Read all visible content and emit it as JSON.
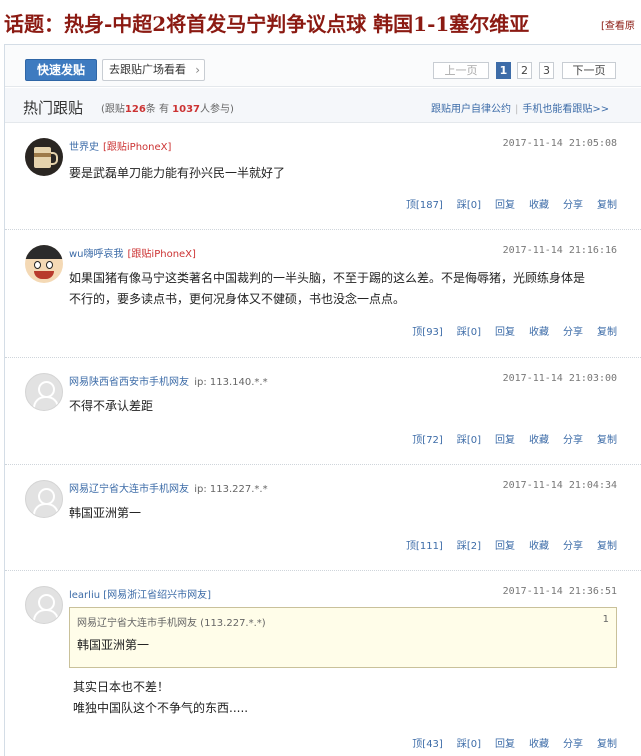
{
  "page": {
    "title": "话题：热身-中超2将首发马宁判争议点球 韩国1-1塞尔维亚",
    "view_link": "[查看原"
  },
  "toolbar": {
    "post_label": "快速发贴",
    "square_label": "去跟贴广场看看",
    "square_icon": "chevron-right-icon",
    "prev_label": "上一页",
    "pages": [
      "1",
      "2",
      "3"
    ],
    "current_page": "1",
    "next_label": "下一页"
  },
  "hot": {
    "title": "热门跟贴",
    "stats_prefix": "(跟贴",
    "reply_count": "126",
    "stats_mid": "条 有",
    "participant_count": "1037",
    "stats_suffix": "人参与)",
    "link_convention": "跟贴用户自律公约",
    "link_mobile": "手机也能看跟贴>>"
  },
  "comments": [
    {
      "avatar_icon": "teacup-avatar",
      "user": "世界史",
      "device": "[跟贴iPhoneX]",
      "time": "2017-11-14 21:05:08",
      "text": "要是武磊单刀能力能有孙兴民一半就好了",
      "actions": [
        "顶[187]",
        "踩[0]",
        "回复",
        "收藏",
        "分享",
        "复制"
      ]
    },
    {
      "avatar_icon": "cartoon-avatar",
      "user": "wu嗨呼哀我",
      "device": "[跟贴iPhoneX]",
      "time": "2017-11-14 21:16:16",
      "text_line1": "如果国猪有像马宁这类著名中国裁判的一半头脑，不至于踢的这么差。不是侮辱猪，光顾练身体是",
      "text_line2": "不行的，要多读点书，更何况身体又不健硕，书也没念一点点。",
      "actions": [
        "顶[93]",
        "踩[0]",
        "回复",
        "收藏",
        "分享",
        "复制"
      ]
    },
    {
      "avatar_icon": "default-user-avatar",
      "user": "网易陕西省西安市手机网友",
      "ip": "ip: 113.140.*.*",
      "time": "2017-11-14 21:03:00",
      "text": "不得不承认差距",
      "actions": [
        "顶[72]",
        "踩[0]",
        "回复",
        "收藏",
        "分享",
        "复制"
      ]
    },
    {
      "avatar_icon": "default-user-avatar",
      "user": "网易辽宁省大连市手机网友",
      "ip": "ip: 113.227.*.*",
      "time": "2017-11-14 21:04:34",
      "text": "韩国亚洲第一",
      "actions": [
        "顶[111]",
        "踩[2]",
        "回复",
        "收藏",
        "分享",
        "复制"
      ]
    },
    {
      "avatar_icon": "default-user-avatar",
      "user": "learliu [网易浙江省绍兴市网友]",
      "time": "2017-11-14 21:36:51",
      "quote_meta": "网易辽宁省大连市手机网友 (113.227.*.*)",
      "quote_num": "1",
      "quote_text": "韩国亚洲第一",
      "text_line1": "其实日本也不差！",
      "text_line2": "唯独中国队这个不争气的东西.....",
      "actions": [
        "顶[43]",
        "踩[0]",
        "回复",
        "收藏",
        "分享",
        "复制"
      ]
    }
  ]
}
